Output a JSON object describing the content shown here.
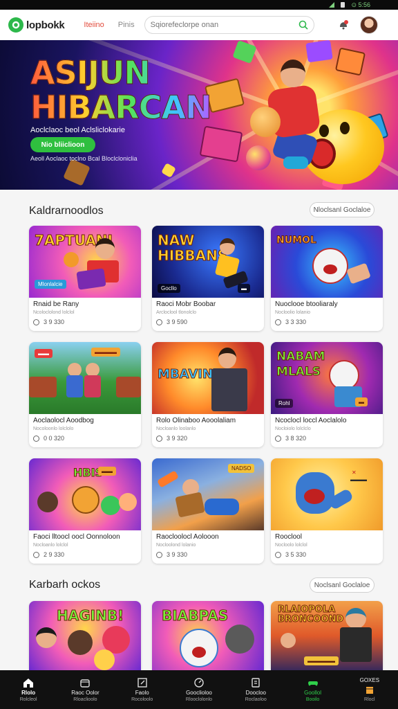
{
  "status": {
    "right_text": "⊙ 5:56"
  },
  "header": {
    "logo_text": "lopbokk",
    "nav": [
      "Iteiino",
      "Pinis"
    ],
    "search_placeholder": "Sqiorefeclorpe onan"
  },
  "hero": {
    "title_line1": "ASIJUN",
    "title_line2": "HIBARCAN",
    "subtitle": "Aoclclaoc beol Aclsliclokarie",
    "cta_label": "Nio bliiclioon",
    "note": "Aeoll Aoclaoc toclno Bcal Bloclcloniclia"
  },
  "sections": [
    {
      "title": "Kaldrarnoodlos",
      "more_label": "Nloclsanl Goclaloe",
      "cards": [
        {
          "title": "Rnaid be Rany",
          "sub": "Ncoloclolond lolclol",
          "stat": "3 9 330",
          "thumb_text": "7APTUANI",
          "badge": "Mlonlalcie"
        },
        {
          "title": "Raoci Mobr Boobar",
          "sub": "Arcloclool tlonolclo",
          "stat": "3 9 590",
          "thumb_text": "NAW HIBBANS",
          "badge": "Gocllo"
        },
        {
          "title": "Nuoclooe btooliaraly",
          "sub": "Nocloolio lolanio",
          "stat": "3 3 330",
          "thumb_text": "NUMOL",
          "badge": ""
        },
        {
          "title": "Aoclaolocl Aoodbog",
          "sub": "Nocoloonlo lolclolo",
          "stat": "0 0 320",
          "thumb_text": "",
          "badge": ""
        },
        {
          "title": "Rolo Olinaboo Aooolaliam",
          "sub": "Nocloanlo loolanlo",
          "stat": "3 9 320",
          "thumb_text": "MBAVINS",
          "badge": ""
        },
        {
          "title": "Ncoclocl loccl Aoclalolo",
          "sub": "Nocloiolo lolclclo",
          "stat": "3 8 320",
          "thumb_text": "NABAM MLALS",
          "badge": "Rohl"
        },
        {
          "title": "Faoci lltoocl oocl Oonnoloon",
          "sub": "Nocloanlo lolclol",
          "stat": "2 9 330",
          "thumb_text": "HBIS",
          "badge": ""
        },
        {
          "title": "Raocloolocl Aolooon",
          "sub": "Nocloolond lolanio",
          "stat": "3 9 330",
          "thumb_text": "NADSO",
          "badge": ""
        },
        {
          "title": "Rooclool",
          "sub": "Nocloolo lolclol",
          "stat": "3 5 330",
          "thumb_text": "",
          "badge": ""
        }
      ]
    },
    {
      "title": "Karbarh ockos",
      "more_label": "Noclsanl Goclaloe",
      "cards": [
        {
          "thumb_text": "HAGINB!"
        },
        {
          "thumb_text": "BIABPAS"
        },
        {
          "thumb_text": "RLAIOPOLA BRONCOOND"
        }
      ]
    }
  ],
  "tabbar": [
    {
      "label": "Rlolo",
      "sub": "Rolcleol",
      "icon": "home-icon"
    },
    {
      "label": "Raoc Oolor",
      "sub": "Rloaclioolo",
      "icon": "store-icon"
    },
    {
      "label": "Faolo",
      "sub": "Rocoloolo",
      "icon": "edit-icon"
    },
    {
      "label": "Gooclioloo",
      "sub": "Rlooclolonlo",
      "icon": "search-icon"
    },
    {
      "label": "Doocloo",
      "sub": "Roclaoloo",
      "icon": "doc-icon"
    },
    {
      "label": "Goollol",
      "sub": "Booilo",
      "icon": "gamepad-icon"
    },
    {
      "label": "GOXES",
      "sub": "Rlocl",
      "icon": "box-icon"
    }
  ],
  "colors": {
    "accent_green": "#2fbf3f",
    "nav_red": "#e24a3b",
    "tabbar_bg": "#111111"
  }
}
